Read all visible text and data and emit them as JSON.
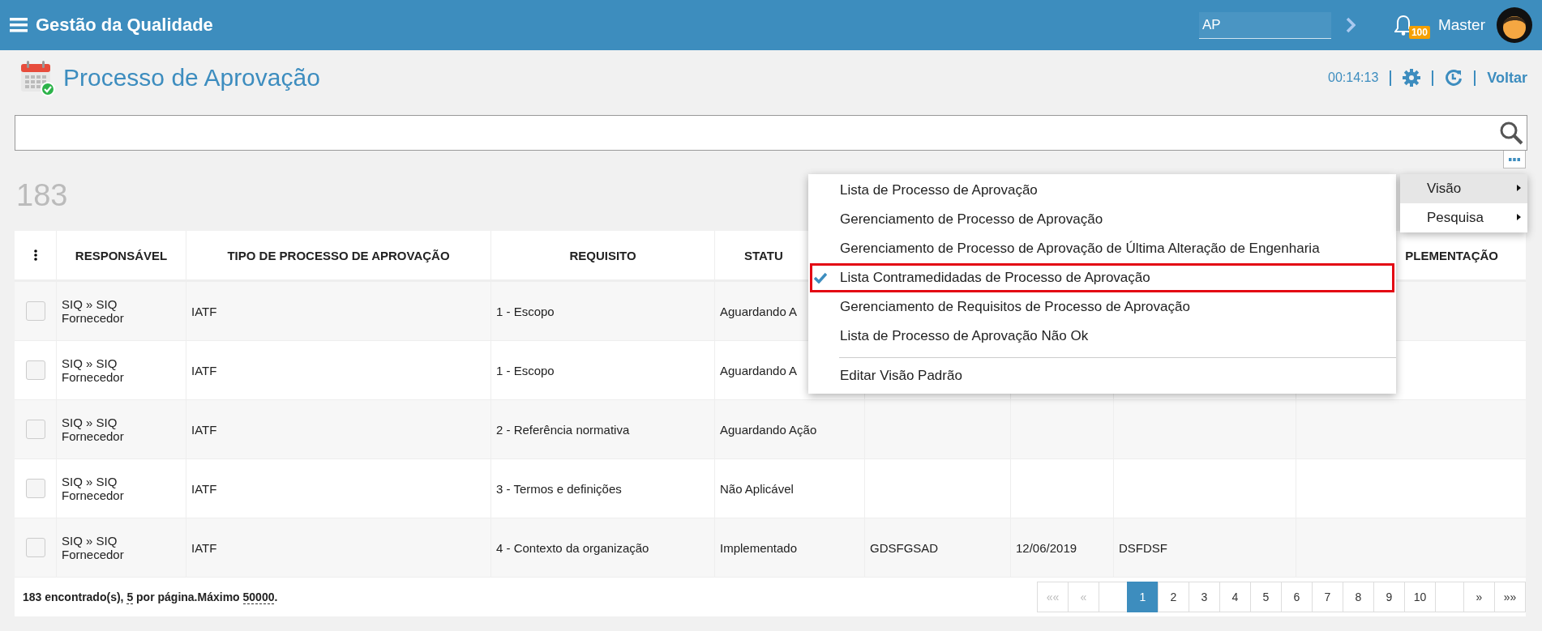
{
  "app_bar": {
    "title": "Gestão da Qualidade",
    "quick_field": {
      "value": "AP"
    },
    "notifications": {
      "count": "100"
    },
    "user": {
      "name": "Master"
    }
  },
  "page": {
    "title": "Processo de Aprovação",
    "time": "00:14:13",
    "back_link": "Voltar"
  },
  "count": "183",
  "table": {
    "columns": [
      {
        "label": "RESPONSÁVEL"
      },
      {
        "label": "TIPO DE PROCESSO DE APROVAÇÃO"
      },
      {
        "label": "REQUISITO"
      },
      {
        "label": "STATU"
      },
      {
        "label": "PLEMENTAÇÃO"
      }
    ],
    "rows": [
      {
        "checked": false,
        "responsible": "SIQ » SIQ Fornecedor",
        "type": "IATF",
        "requirement": "1 - Escopo",
        "status": "Aguardando A"
      },
      {
        "checked": false,
        "responsible": "SIQ » SIQ Fornecedor",
        "type": "IATF",
        "requirement": "1 - Escopo",
        "status": "Aguardando A"
      },
      {
        "checked": false,
        "responsible": "SIQ » SIQ Fornecedor",
        "type": "IATF",
        "requirement": "2 - Referência normativa",
        "status": "Aguardando Ação"
      },
      {
        "checked": false,
        "responsible": "SIQ » SIQ Fornecedor",
        "type": "IATF",
        "requirement": "3 - Termos e definições",
        "status": "Não Aplicável"
      },
      {
        "checked": false,
        "responsible": "SIQ » SIQ Fornecedor",
        "type": "IATF",
        "requirement": "4 - Contexto da organização",
        "status": "Implementado",
        "column_5": "GDSFGSAD",
        "column_6": "12/06/2019",
        "column_7": "DSFDSF"
      }
    ]
  },
  "footer": {
    "summary": [
      {
        "kind": "text",
        "text": "183 encontrado(s), "
      },
      {
        "kind": "link",
        "text": "5"
      },
      {
        "kind": "text",
        "text": " por página.Máximo "
      },
      {
        "kind": "link",
        "text": "50000"
      },
      {
        "kind": "text",
        "text": "."
      }
    ],
    "pagination": [
      {
        "label": "««",
        "kind": "nav",
        "disabled": true,
        "selected": false
      },
      {
        "label": "«",
        "kind": "nav",
        "disabled": true,
        "selected": false
      },
      {
        "kind": "gap"
      },
      {
        "label": "1",
        "kind": "page",
        "selected": true
      },
      {
        "label": "2",
        "kind": "page",
        "selected": false
      },
      {
        "label": "3",
        "kind": "page",
        "selected": false
      },
      {
        "label": "4",
        "kind": "page",
        "selected": false
      },
      {
        "label": "5",
        "kind": "page",
        "selected": false
      },
      {
        "label": "6",
        "kind": "page",
        "selected": false
      },
      {
        "label": "7",
        "kind": "page",
        "selected": false
      },
      {
        "label": "8",
        "kind": "page",
        "selected": false
      },
      {
        "label": "9",
        "kind": "page",
        "selected": false
      },
      {
        "label": "10",
        "kind": "page",
        "selected": false
      },
      {
        "kind": "gap"
      },
      {
        "label": "»",
        "kind": "nav",
        "disabled": false,
        "selected": false
      },
      {
        "label": "»»",
        "kind": "nav",
        "disabled": false,
        "selected": false
      }
    ]
  },
  "view_menu": {
    "items": [
      {
        "label": "Lista de Processo de Aprovação",
        "checked": false
      },
      {
        "label": "Gerenciamento de Processo de Aprovação",
        "checked": false
      },
      {
        "label": "Gerenciamento de Processo de Aprovação de Última Alteração de Engenharia",
        "checked": false
      },
      {
        "label": "Lista Contramedidadas de Processo de Aprovação",
        "checked": true
      },
      {
        "label": "Gerenciamento de Requisitos de Processo de Aprovação",
        "checked": false
      },
      {
        "label": "Lista de Processo de Aprovação Não Ok",
        "checked": false
      }
    ],
    "footer_item": "Editar Visão Padrão"
  },
  "options_menu": {
    "items": [
      {
        "label": "Visão",
        "selected": true
      },
      {
        "label": "Pesquisa",
        "selected": false
      }
    ]
  }
}
